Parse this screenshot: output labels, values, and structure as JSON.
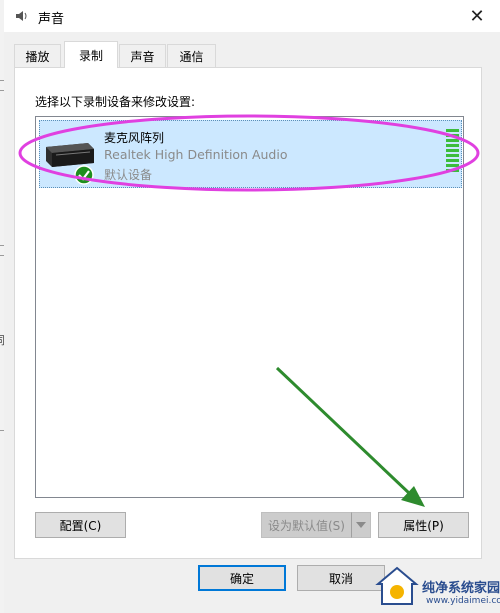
{
  "window": {
    "title": "声音",
    "close_symbol": "✕"
  },
  "tabs": [
    {
      "label": "播放",
      "active": false
    },
    {
      "label": "录制",
      "active": true
    },
    {
      "label": "声音",
      "active": false
    },
    {
      "label": "通信",
      "active": false
    }
  ],
  "panel": {
    "instruction": "选择以下录制设备来修改设置:"
  },
  "devices": [
    {
      "name": "麦克风阵列",
      "description": "Realtek High Definition Audio",
      "status": "默认设备",
      "icon": "microphone-array-icon",
      "badge": "default-check-icon",
      "selected": true,
      "level_bars_lit": 9
    }
  ],
  "buttons": {
    "configure": "配置(C)",
    "set_default": "设为默认值(S)",
    "properties": "属性(P)",
    "ok": "确定",
    "cancel": "取消"
  },
  "annotations": {
    "highlight_color": "#e040e0",
    "arrow_color": "#2e8b2e"
  },
  "watermark": {
    "brand": "纯净系统家园",
    "url": "www.yidaimei.com"
  },
  "background_fragment": "同"
}
